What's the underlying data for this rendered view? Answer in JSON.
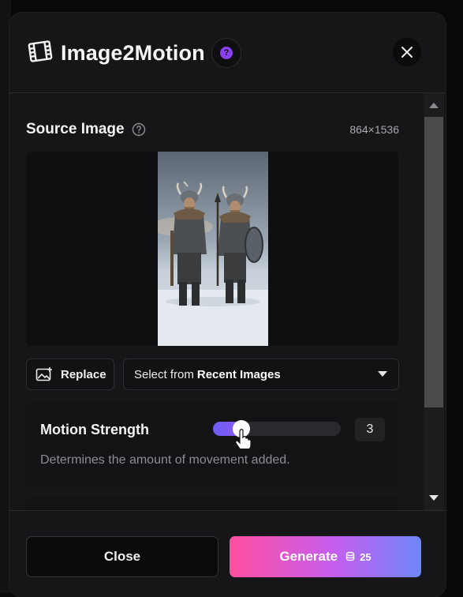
{
  "app": {
    "title": "Image2Motion",
    "help_glyph": "?"
  },
  "source": {
    "title": "Source Image",
    "dimensions": "864×1536"
  },
  "actions": {
    "replace_label": "Replace",
    "recent_prefix": "Select from",
    "recent_strong": "Recent Images"
  },
  "motion": {
    "label": "Motion Strength",
    "value": "3",
    "level": 0.22,
    "description": "Determines the amount of movement added."
  },
  "footer": {
    "close_label": "Close",
    "generate_label": "Generate",
    "credits": "25"
  },
  "icons": {
    "header": "film-icon",
    "help": "question-icon",
    "close": "close-icon",
    "replace": "image-plus-icon",
    "dropdown": "chevron-down-icon",
    "scroll_up": "arrow-up-icon",
    "scroll_down": "arrow-down-icon",
    "coins": "coins-icon",
    "cursor": "hand-pointer-icon"
  },
  "colors": {
    "accent_purple": "#8a3ff0",
    "slider_fill": "#7a5cf3",
    "generate_start": "#ff4fa0",
    "generate_end": "#6d86f7"
  }
}
